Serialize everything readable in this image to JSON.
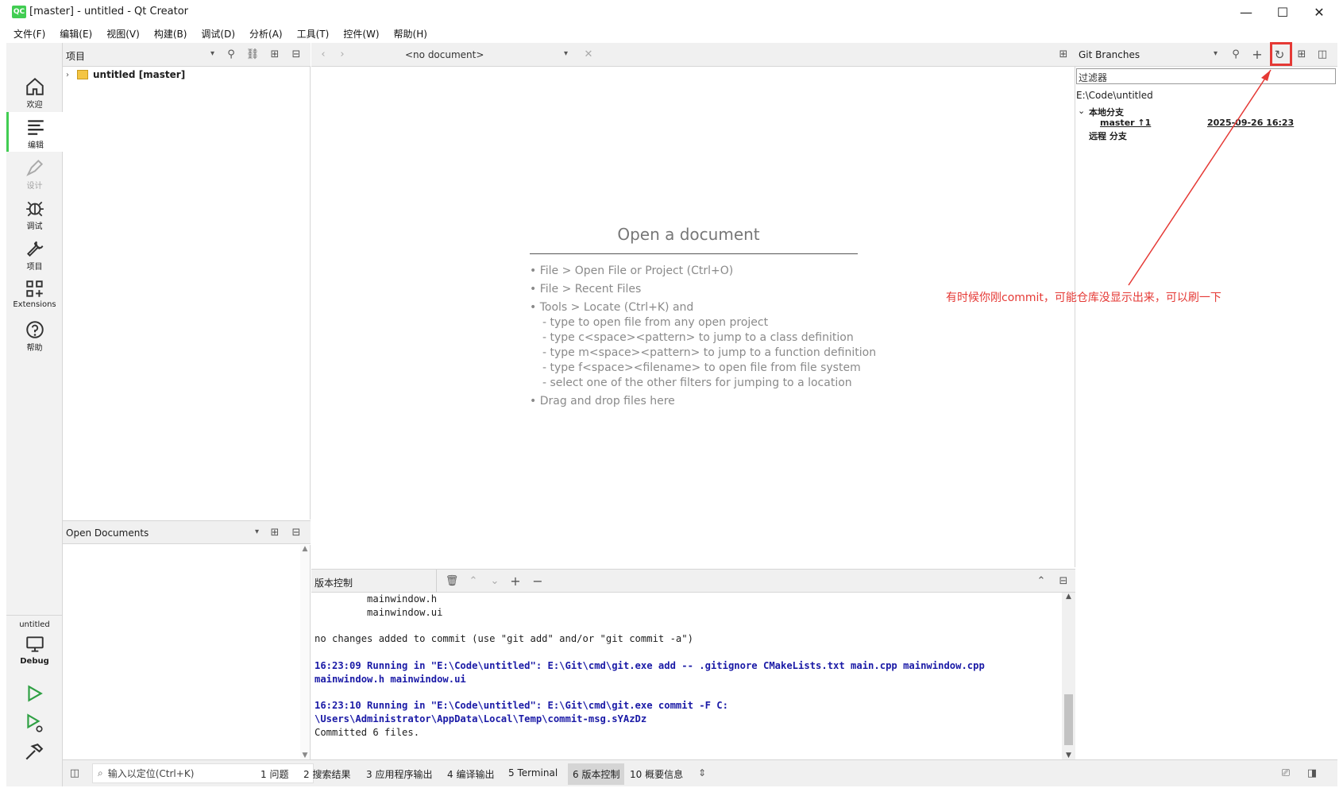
{
  "window": {
    "title": "[master] - untitled - Qt Creator",
    "logo": "QC"
  },
  "menu": [
    "文件(F)",
    "编辑(E)",
    "视图(V)",
    "构建(B)",
    "调试(D)",
    "分析(A)",
    "工具(T)",
    "控件(W)",
    "帮助(H)"
  ],
  "modes": [
    {
      "label": "欢迎",
      "icon": "home-icon"
    },
    {
      "label": "编辑",
      "icon": "edit-icon"
    },
    {
      "label": "设计",
      "icon": "design-icon"
    },
    {
      "label": "调试",
      "icon": "debug-icon"
    },
    {
      "label": "项目",
      "icon": "wrench-icon"
    },
    {
      "label": "Extensions",
      "icon": "extensions-icon"
    },
    {
      "label": "帮助",
      "icon": "help-icon"
    }
  ],
  "target": {
    "project": "untitled",
    "config": "Debug"
  },
  "project_pane": {
    "selector": "项目",
    "tree": [
      {
        "label": "untitled [master]"
      }
    ]
  },
  "open_documents": {
    "selector": "Open Documents"
  },
  "editor": {
    "doc_selector": "<no document>",
    "title": "Open a document",
    "hints": [
      "• File > Open File or Project (Ctrl+O)",
      "• File > Recent Files",
      "• Tools > Locate (Ctrl+K) and",
      "- type to open file from any open project",
      "- type c<space><pattern> to jump to a class definition",
      "- type m<space><pattern> to jump to a function definition",
      "- type f<space><filename> to open file from file system",
      "- select one of the other filters for jumping to a location",
      "• Drag and drop files here"
    ]
  },
  "git": {
    "selector": "Git Branches",
    "filter_placeholder": "过滤器",
    "repo_path": "E:\\Code\\untitled",
    "local_label": "本地分支",
    "branch_name": "master ↑1",
    "branch_date": "2025-09-26 16:23",
    "remote_label": "远程 分支"
  },
  "vc": {
    "selector": "版本控制",
    "lines": [
      {
        "text": "         mainwindow.h",
        "style": "normal"
      },
      {
        "text": "         mainwindow.ui",
        "style": "normal"
      },
      {
        "text": "",
        "style": "normal"
      },
      {
        "text": "no changes added to commit (use \"git add\" and/or \"git commit -a\")",
        "style": "normal"
      },
      {
        "text": "",
        "style": "normal"
      },
      {
        "text": "16:23:09 Running in \"E:\\Code\\untitled\": E:\\Git\\cmd\\git.exe add -- .gitignore CMakeLists.txt main.cpp mainwindow.cpp",
        "style": "cmd"
      },
      {
        "text": "mainwindow.h mainwindow.ui",
        "style": "cmd"
      },
      {
        "text": "",
        "style": "normal"
      },
      {
        "text": "16:23:10 Running in \"E:\\Code\\untitled\": E:\\Git\\cmd\\git.exe commit -F C:",
        "style": "cmd"
      },
      {
        "text": "\\Users\\Administrator\\AppData\\Local\\Temp\\commit-msg.sYAzDz",
        "style": "cmd"
      },
      {
        "text": "Committed 6 files.",
        "style": "normal"
      }
    ]
  },
  "statusbar": {
    "locator_placeholder": "输入以定位(Ctrl+K)",
    "tabs": [
      "1  问题",
      "2  搜索结果",
      "3  应用程序输出",
      "4  编译输出",
      "5  Terminal",
      "6  版本控制",
      "10  概要信息"
    ]
  },
  "annotation": {
    "text": "有时候你刚commit，可能仓库没显示出来，可以刷一下",
    "color": "#e53935"
  },
  "colors": {
    "accent": "#41cd52",
    "command_text": "#1a1aa6"
  }
}
